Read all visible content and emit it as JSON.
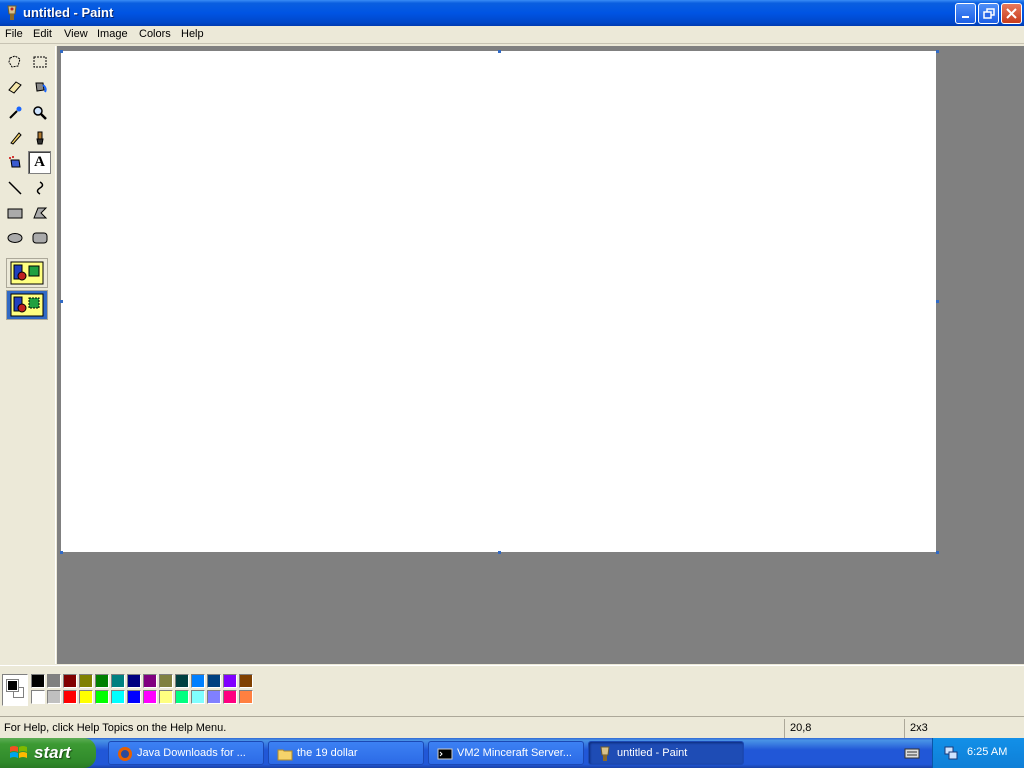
{
  "window": {
    "title": "untitled - Paint"
  },
  "menu": [
    "File",
    "Edit",
    "View",
    "Image",
    "Colors",
    "Help"
  ],
  "tools": [
    {
      "name": "free-form-select-icon"
    },
    {
      "name": "select-icon"
    },
    {
      "name": "eraser-icon"
    },
    {
      "name": "fill-with-color-icon"
    },
    {
      "name": "pick-color-icon"
    },
    {
      "name": "magnifier-icon"
    },
    {
      "name": "pencil-icon"
    },
    {
      "name": "brush-icon"
    },
    {
      "name": "airbrush-icon"
    },
    {
      "name": "text-icon",
      "glyph": "A",
      "active": true
    },
    {
      "name": "line-icon"
    },
    {
      "name": "curve-icon"
    },
    {
      "name": "rectangle-icon"
    },
    {
      "name": "polygon-icon"
    },
    {
      "name": "ellipse-icon"
    },
    {
      "name": "rounded-rectangle-icon"
    }
  ],
  "palette": {
    "foreground": "#000000",
    "background": "#ffffff",
    "row1": [
      "#000000",
      "#808080",
      "#800000",
      "#808000",
      "#008000",
      "#008080",
      "#000080",
      "#800080",
      "#808040",
      "#004040",
      "#0080ff",
      "#004080",
      "#8000ff",
      "#804000"
    ],
    "row2": [
      "#ffffff",
      "#c0c0c0",
      "#ff0000",
      "#ffff00",
      "#00ff00",
      "#00ffff",
      "#0000ff",
      "#ff00ff",
      "#ffff80",
      "#00ff80",
      "#80ffff",
      "#8080ff",
      "#ff0080",
      "#ff8040"
    ]
  },
  "status": {
    "help": "For Help, click Help Topics on the Help Menu.",
    "coords": "20,8",
    "size": "2x3"
  },
  "taskbar": {
    "start_label": "start",
    "tasks": [
      {
        "label": "Java Downloads for ...",
        "icon": "firefox-icon"
      },
      {
        "label": "the 19 dollar",
        "icon": "folder-icon"
      },
      {
        "label": "VM2 Minceraft Server...",
        "icon": "command-prompt-icon"
      },
      {
        "label": "untitled - Paint",
        "icon": "paint-icon",
        "active": true
      }
    ],
    "clock": "6:25 AM"
  }
}
